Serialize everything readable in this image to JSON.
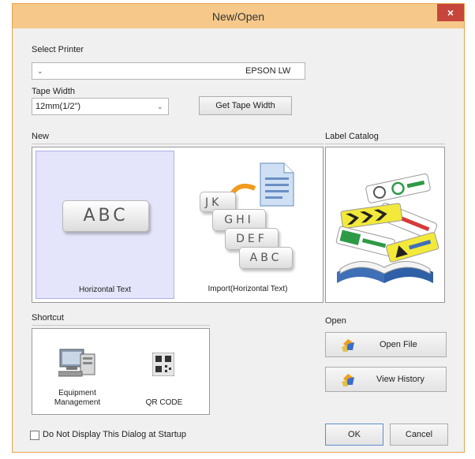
{
  "window": {
    "title": "New/Open",
    "close_glyph": "×"
  },
  "printer": {
    "label": "Select Printer",
    "value": "EPSON LW",
    "arrow_glyph": "⌄"
  },
  "tape": {
    "label": "Tape Width",
    "value": "12mm(1/2\")",
    "arrow_glyph": "⌄",
    "get_button": "Get Tape Width"
  },
  "new_section": {
    "label": "New",
    "tiles": [
      {
        "label": "Horizontal Text",
        "card_text": "ABC"
      },
      {
        "label": "Import(Horizontal Text)",
        "cards": [
          "JK",
          "GHI",
          "DEF",
          "ABC"
        ]
      }
    ]
  },
  "catalog": {
    "label": "Label Catalog"
  },
  "shortcut": {
    "label": "Shortcut",
    "items": [
      {
        "label_line1": "Equipment",
        "label_line2": "Management"
      },
      {
        "label": "QR CODE"
      }
    ]
  },
  "open_section": {
    "label": "Open",
    "open_file": "Open File",
    "view_history": "View History"
  },
  "footer": {
    "checkbox_label": "Do Not Display This Dialog at Startup",
    "ok": "OK",
    "cancel": "Cancel"
  },
  "colors": {
    "title_bar": "#f6c98a",
    "close": "#c7463b",
    "selected_tile": "#e4e4fa",
    "window_bg": "#f0f0f0"
  }
}
